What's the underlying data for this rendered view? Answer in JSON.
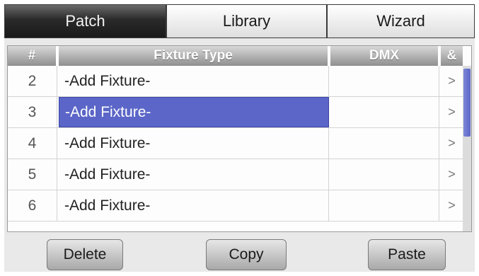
{
  "tabs": [
    {
      "label": "Patch",
      "active": true
    },
    {
      "label": "Library",
      "active": false
    },
    {
      "label": "Wizard",
      "active": false
    }
  ],
  "table": {
    "headers": {
      "num": "#",
      "type": "Fixture Type",
      "dmx": "DMX",
      "extra": "&"
    },
    "rows": [
      {
        "num": "2",
        "type": "-Add Fixture-",
        "dmx": "",
        "go": ">",
        "selected": false
      },
      {
        "num": "3",
        "type": "-Add Fixture-",
        "dmx": "",
        "go": ">",
        "selected": true
      },
      {
        "num": "4",
        "type": "-Add Fixture-",
        "dmx": "",
        "go": ">",
        "selected": false
      },
      {
        "num": "5",
        "type": "-Add Fixture-",
        "dmx": "",
        "go": ">",
        "selected": false
      },
      {
        "num": "6",
        "type": "-Add Fixture-",
        "dmx": "",
        "go": ">",
        "selected": false
      }
    ]
  },
  "buttons": {
    "delete": "Delete",
    "copy": "Copy",
    "paste": "Paste"
  },
  "colors": {
    "selection": "#5b66c8",
    "active_tab": "#2a2a2a"
  }
}
